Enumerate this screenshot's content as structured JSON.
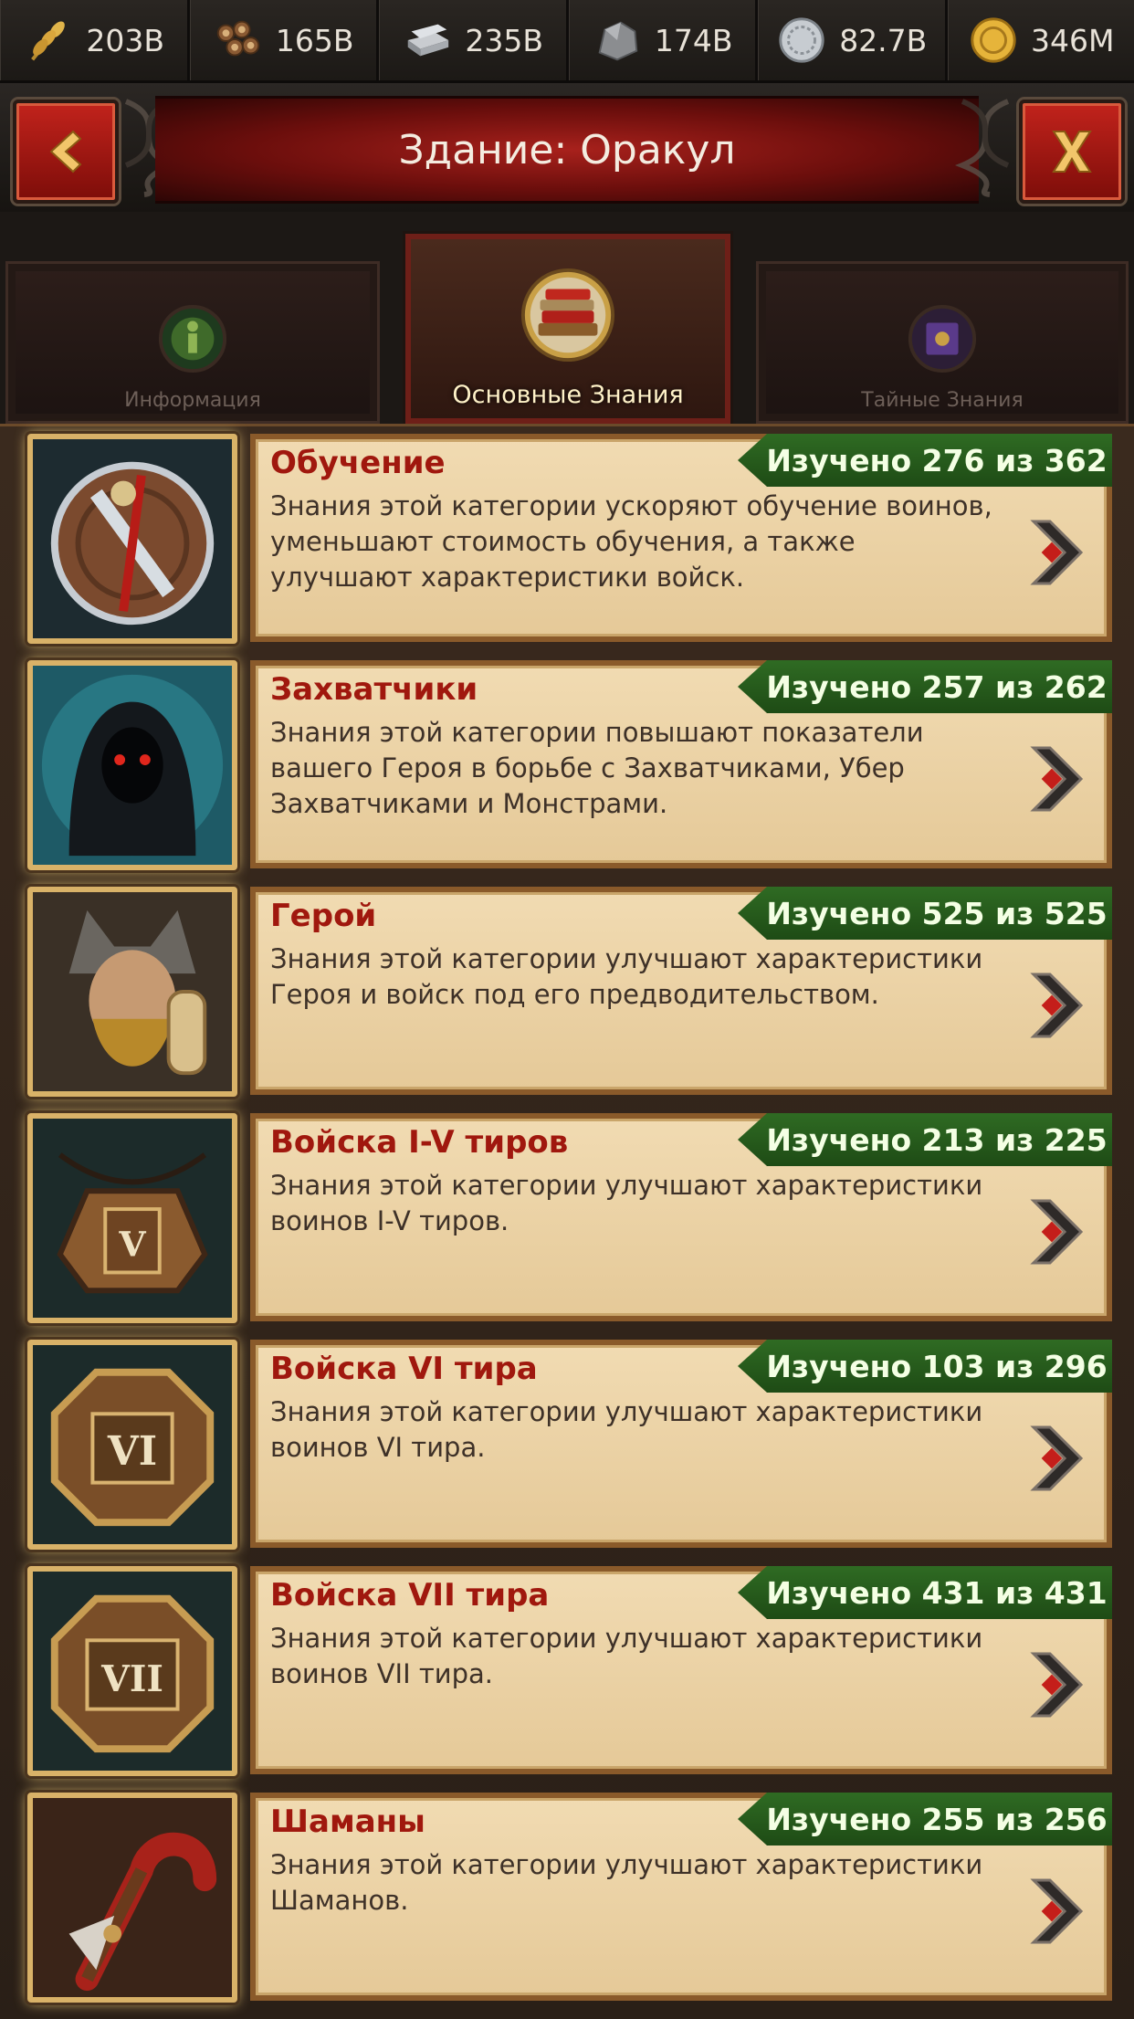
{
  "resources": [
    {
      "icon": "wheat-icon",
      "value": "203B"
    },
    {
      "icon": "wood-icon",
      "value": "165B"
    },
    {
      "icon": "iron-icon",
      "value": "235B"
    },
    {
      "icon": "stone-icon",
      "value": "174B"
    },
    {
      "icon": "silver-icon",
      "value": "82.7B"
    },
    {
      "icon": "gold-icon",
      "value": "346M"
    }
  ],
  "header": {
    "title": "Здание: Оракул"
  },
  "tabs": [
    {
      "label": "Информация",
      "icon": "info-icon"
    },
    {
      "label": "Основные Знания",
      "icon": "books-icon"
    },
    {
      "label": "Тайные Знания",
      "icon": "secret-book-icon"
    }
  ],
  "categories": [
    {
      "title": "Обучение",
      "progress": "Изучено 276 из 362",
      "desc": "Знания этой категории ускоряют обучение воинов, уменьшают стоимость обучения, а также улучшают характеристики войск."
    },
    {
      "title": "Захватчики",
      "progress": "Изучено 257 из 262",
      "desc": "Знания этой категории повышают показатели вашего Героя в борьбе с Захватчиками, Убер Захватчиками и Монстрами."
    },
    {
      "title": "Герой",
      "progress": "Изучено 525 из 525",
      "desc": "Знания этой категории улучшают характеристики Героя и войск под его предводительством."
    },
    {
      "title": "Войска I-V тиров",
      "progress": "Изучено 213 из 225",
      "desc": "Знания этой категории улучшают характеристики воинов I-V тиров."
    },
    {
      "title": "Войска VI тира",
      "progress": "Изучено 103 из 296",
      "desc": "Знания этой категории улучшают характеристики воинов VI тира."
    },
    {
      "title": "Войска VII тира",
      "progress": "Изучено 431 из 431",
      "desc": "Знания этой категории улучшают характеристики воинов VII тира."
    },
    {
      "title": "Шаманы",
      "progress": "Изучено 255 из 256",
      "desc": "Знания этой категории улучшают характеристики Шаманов."
    }
  ],
  "thumb_labels": {
    "tier5": "V",
    "tier6": "VI",
    "tier7": "VII"
  },
  "colors": {
    "title_red": "#a0180e",
    "progress_green": "#2f6b23",
    "card_bg": "#ecd3a6",
    "accent_red": "#b71c17"
  }
}
